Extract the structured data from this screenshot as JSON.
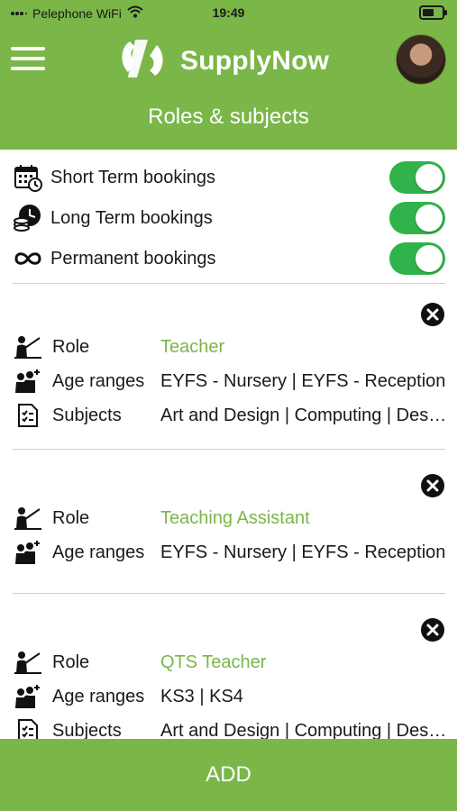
{
  "status_bar": {
    "carrier": "Pelephone WiFi",
    "time": "19:49"
  },
  "header": {
    "brand": "SupplyNow",
    "title": "Roles & subjects"
  },
  "bookings": [
    {
      "label": "Short Term bookings",
      "enabled": true,
      "icon": "calendar-clock-icon"
    },
    {
      "label": "Long Term bookings",
      "enabled": true,
      "icon": "clock-coins-icon"
    },
    {
      "label": "Permanent bookings",
      "enabled": true,
      "icon": "infinity-icon"
    }
  ],
  "roles": [
    {
      "role_key": "Role",
      "role": "Teacher",
      "age_key": "Age ranges",
      "ages": "EYFS - Nursery | EYFS - Reception",
      "subjects_key": "Subjects",
      "subjects": "Art and Design | Computing | Design"
    },
    {
      "role_key": "Role",
      "role": "Teaching Assistant",
      "age_key": "Age ranges",
      "ages": "EYFS - Nursery | EYFS - Reception"
    },
    {
      "role_key": "Role",
      "role": "QTS Teacher",
      "age_key": "Age ranges",
      "ages": "KS3 | KS4",
      "subjects_key": "Subjects",
      "subjects": "Art and Design | Computing | Design"
    }
  ],
  "footer": {
    "add_label": "ADD"
  },
  "colors": {
    "brand_green": "#7ab648",
    "toggle_on": "#2fb34a"
  }
}
